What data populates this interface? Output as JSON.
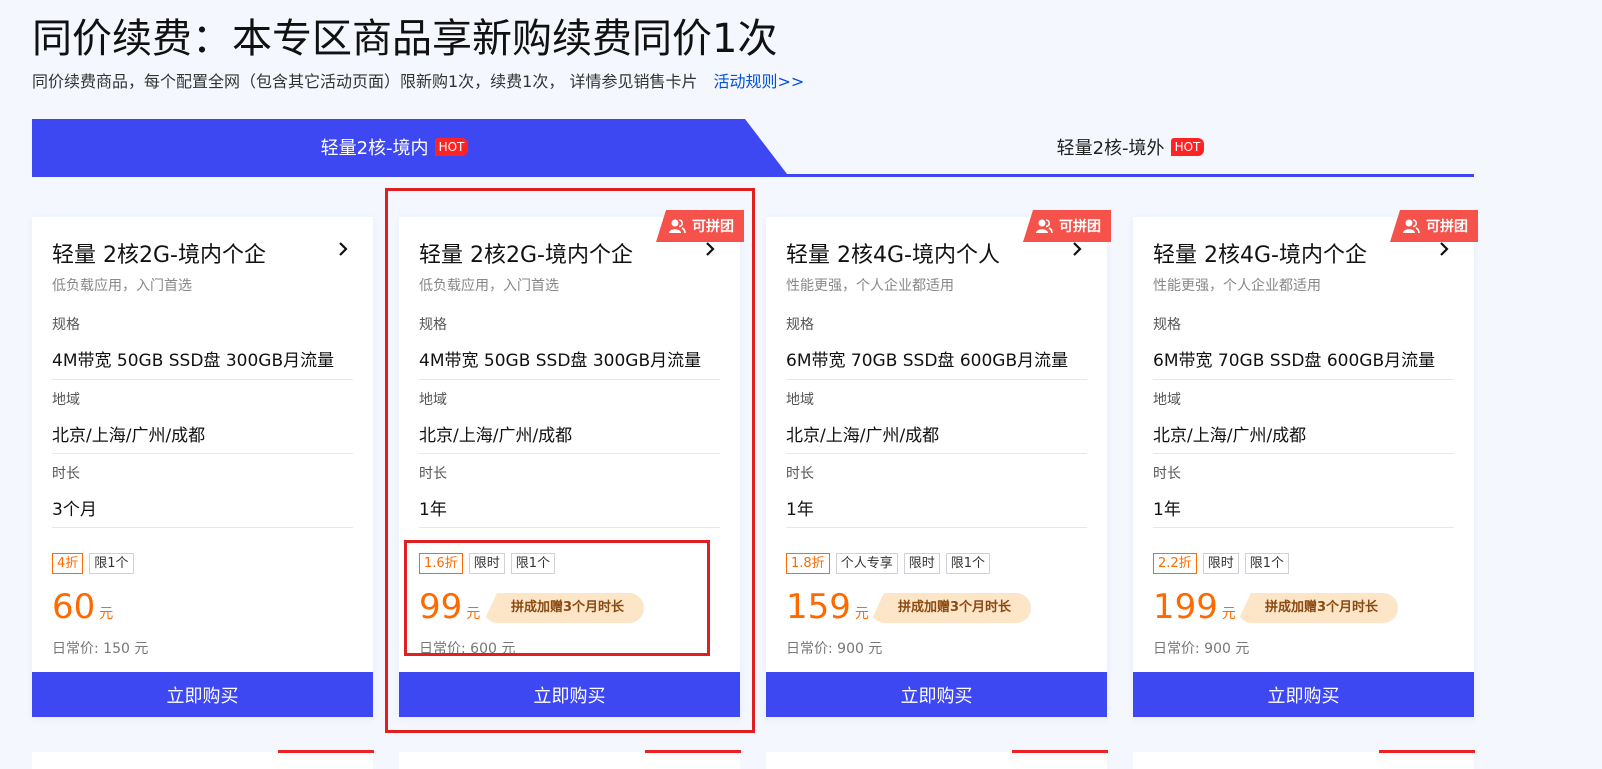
{
  "page": {
    "title": "同价续费：本专区商品享新购续费同价1次",
    "subtitle": "同价续费商品，每个配置全网（包含其它活动页面）限新购1次，续费1次，  详情参见销售卡片",
    "rules_link": "活动规则>>"
  },
  "tabs": [
    {
      "label": "轻量2核-境内",
      "badge": "HOT",
      "active": true
    },
    {
      "label": "轻量2核-境外",
      "badge": "HOT",
      "active": false
    }
  ],
  "labels": {
    "spec": "规格",
    "region": "地域",
    "duration": "时长",
    "group_badge": "可拼团",
    "buy": "立即购买",
    "currency": "元",
    "orig_prefix": "日常价: ",
    "orig_suffix": " 元"
  },
  "cards": [
    {
      "title": "轻量 2核2G-境内个企",
      "desc": "低负载应用，入门首选",
      "spec": "4M带宽 50GB SSD盘 300GB月流量",
      "region": "北京/上海/广州/成都",
      "duration": "3个月",
      "tags": [
        "4折",
        "限1个"
      ],
      "price": "60",
      "bonus": "",
      "orig": "日常价: 150 元",
      "group": false
    },
    {
      "title": "轻量 2核2G-境内个企",
      "desc": "低负载应用，入门首选",
      "spec": "4M带宽 50GB SSD盘 300GB月流量",
      "region": "北京/上海/广州/成都",
      "duration": "1年",
      "tags": [
        "1.6折",
        "限时",
        "限1个"
      ],
      "price": "99",
      "bonus": "拼成加赠3个月时长",
      "orig": "日常价: 600 元",
      "group": true
    },
    {
      "title": "轻量 2核4G-境内个人",
      "desc": "性能更强，个人企业都适用",
      "spec": "6M带宽 70GB SSD盘 600GB月流量",
      "region": "北京/上海/广州/成都",
      "duration": "1年",
      "tags": [
        "1.8折",
        "个人专享",
        "限时",
        "限1个"
      ],
      "price": "159",
      "bonus": "拼成加赠3个月时长",
      "orig": "日常价: 900 元",
      "group": true
    },
    {
      "title": "轻量 2核4G-境内个企",
      "desc": "性能更强，个人企业都适用",
      "spec": "6M带宽 70GB SSD盘 600GB月流量",
      "region": "北京/上海/广州/成都",
      "duration": "1年",
      "tags": [
        "2.2折",
        "限时",
        "限1个"
      ],
      "price": "199",
      "bonus": "拼成加赠3个月时长",
      "orig": "日常价: 900 元",
      "group": true
    }
  ],
  "colors": {
    "accent": "#3d47f2",
    "price": "#ff6a00",
    "hot": "#ff2424",
    "highlight_box": "#e02020"
  }
}
